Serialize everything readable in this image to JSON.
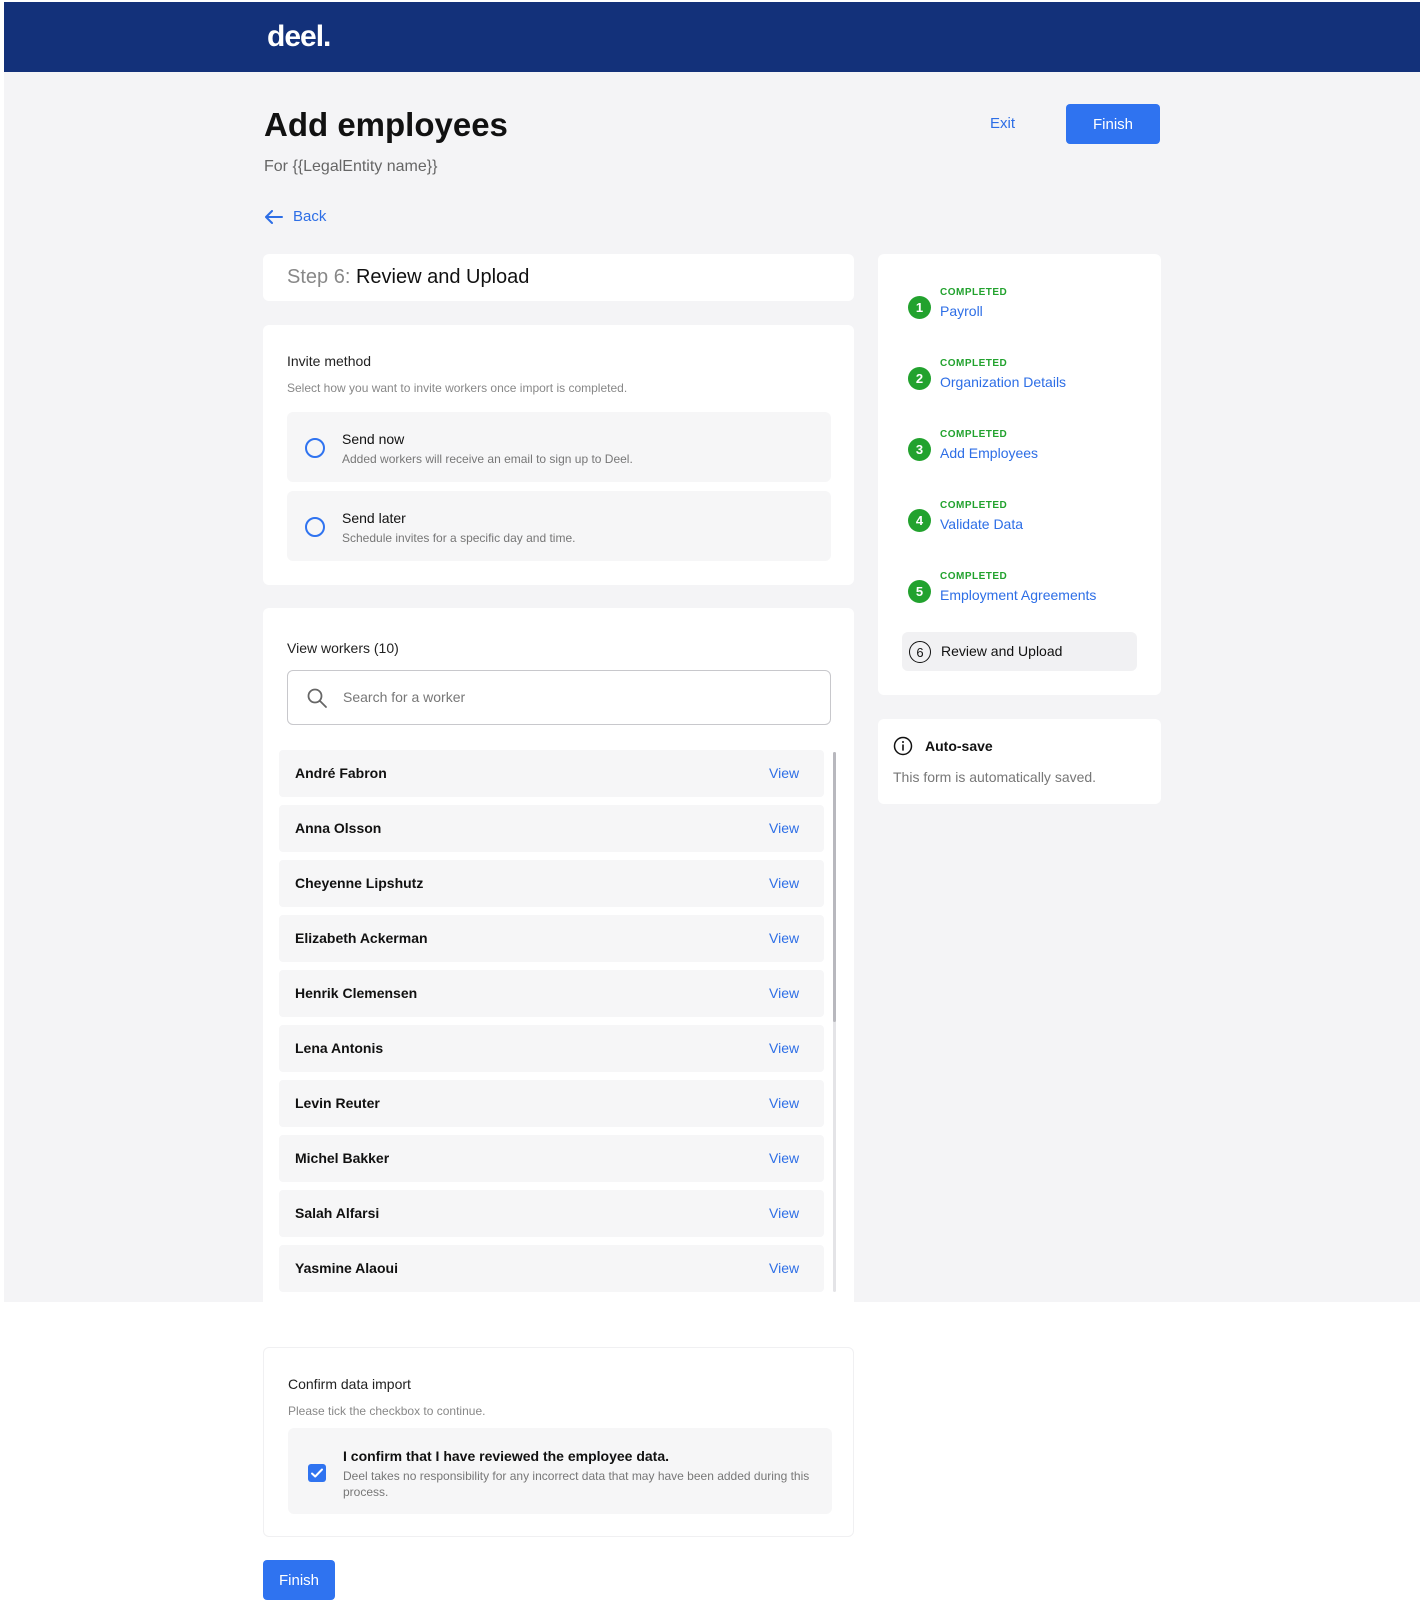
{
  "header": {
    "logo": "deel."
  },
  "page": {
    "title": "Add employees",
    "subtitle": "For {{LegalEntity name}}",
    "exit_label": "Exit",
    "finish_label": "Finish",
    "back_label": "Back"
  },
  "step": {
    "prefix": "Step 6:",
    "title": "Review and Upload"
  },
  "invite": {
    "title": "Invite method",
    "description": "Select how you want to invite workers once import is completed.",
    "options": [
      {
        "title": "Send now",
        "description": "Added workers will receive an email to sign up to Deel."
      },
      {
        "title": "Send later",
        "description": "Schedule invites for a specific day and time."
      }
    ]
  },
  "workers": {
    "title": "View workers (10)",
    "search_placeholder": "Search for a worker",
    "view_label": "View",
    "list": [
      "André Fabron",
      "Anna Olsson",
      "Cheyenne Lipshutz",
      "Elizabeth Ackerman",
      "Henrik Clemensen",
      "Lena Antonis",
      "Levin Reuter",
      "Michel Bakker",
      "Salah Alfarsi",
      "Yasmine Alaoui"
    ]
  },
  "confirm": {
    "title": "Confirm data import",
    "description": "Please tick the checkbox to continue.",
    "checkbox_title": "I confirm that I have reviewed the employee data.",
    "checkbox_description": "Deel takes no responsibility for any incorrect data that may have been added during this process.",
    "checked": true
  },
  "finish_bottom_label": "Finish",
  "steps": [
    {
      "number": "1",
      "status": "COMPLETED",
      "label": "Payroll"
    },
    {
      "number": "2",
      "status": "COMPLETED",
      "label": "Organization Details"
    },
    {
      "number": "3",
      "status": "COMPLETED",
      "label": "Add Employees"
    },
    {
      "number": "4",
      "status": "COMPLETED",
      "label": "Validate Data"
    },
    {
      "number": "5",
      "status": "COMPLETED",
      "label": "Employment Agreements"
    },
    {
      "number": "6",
      "status": "",
      "label": "Review and Upload"
    }
  ],
  "autosave": {
    "title": "Auto-save",
    "description": "This form is automatically saved."
  },
  "colors": {
    "brand": "#13317a",
    "accent": "#2f73f0",
    "link": "#2d6ee6",
    "success": "#22a22e"
  }
}
